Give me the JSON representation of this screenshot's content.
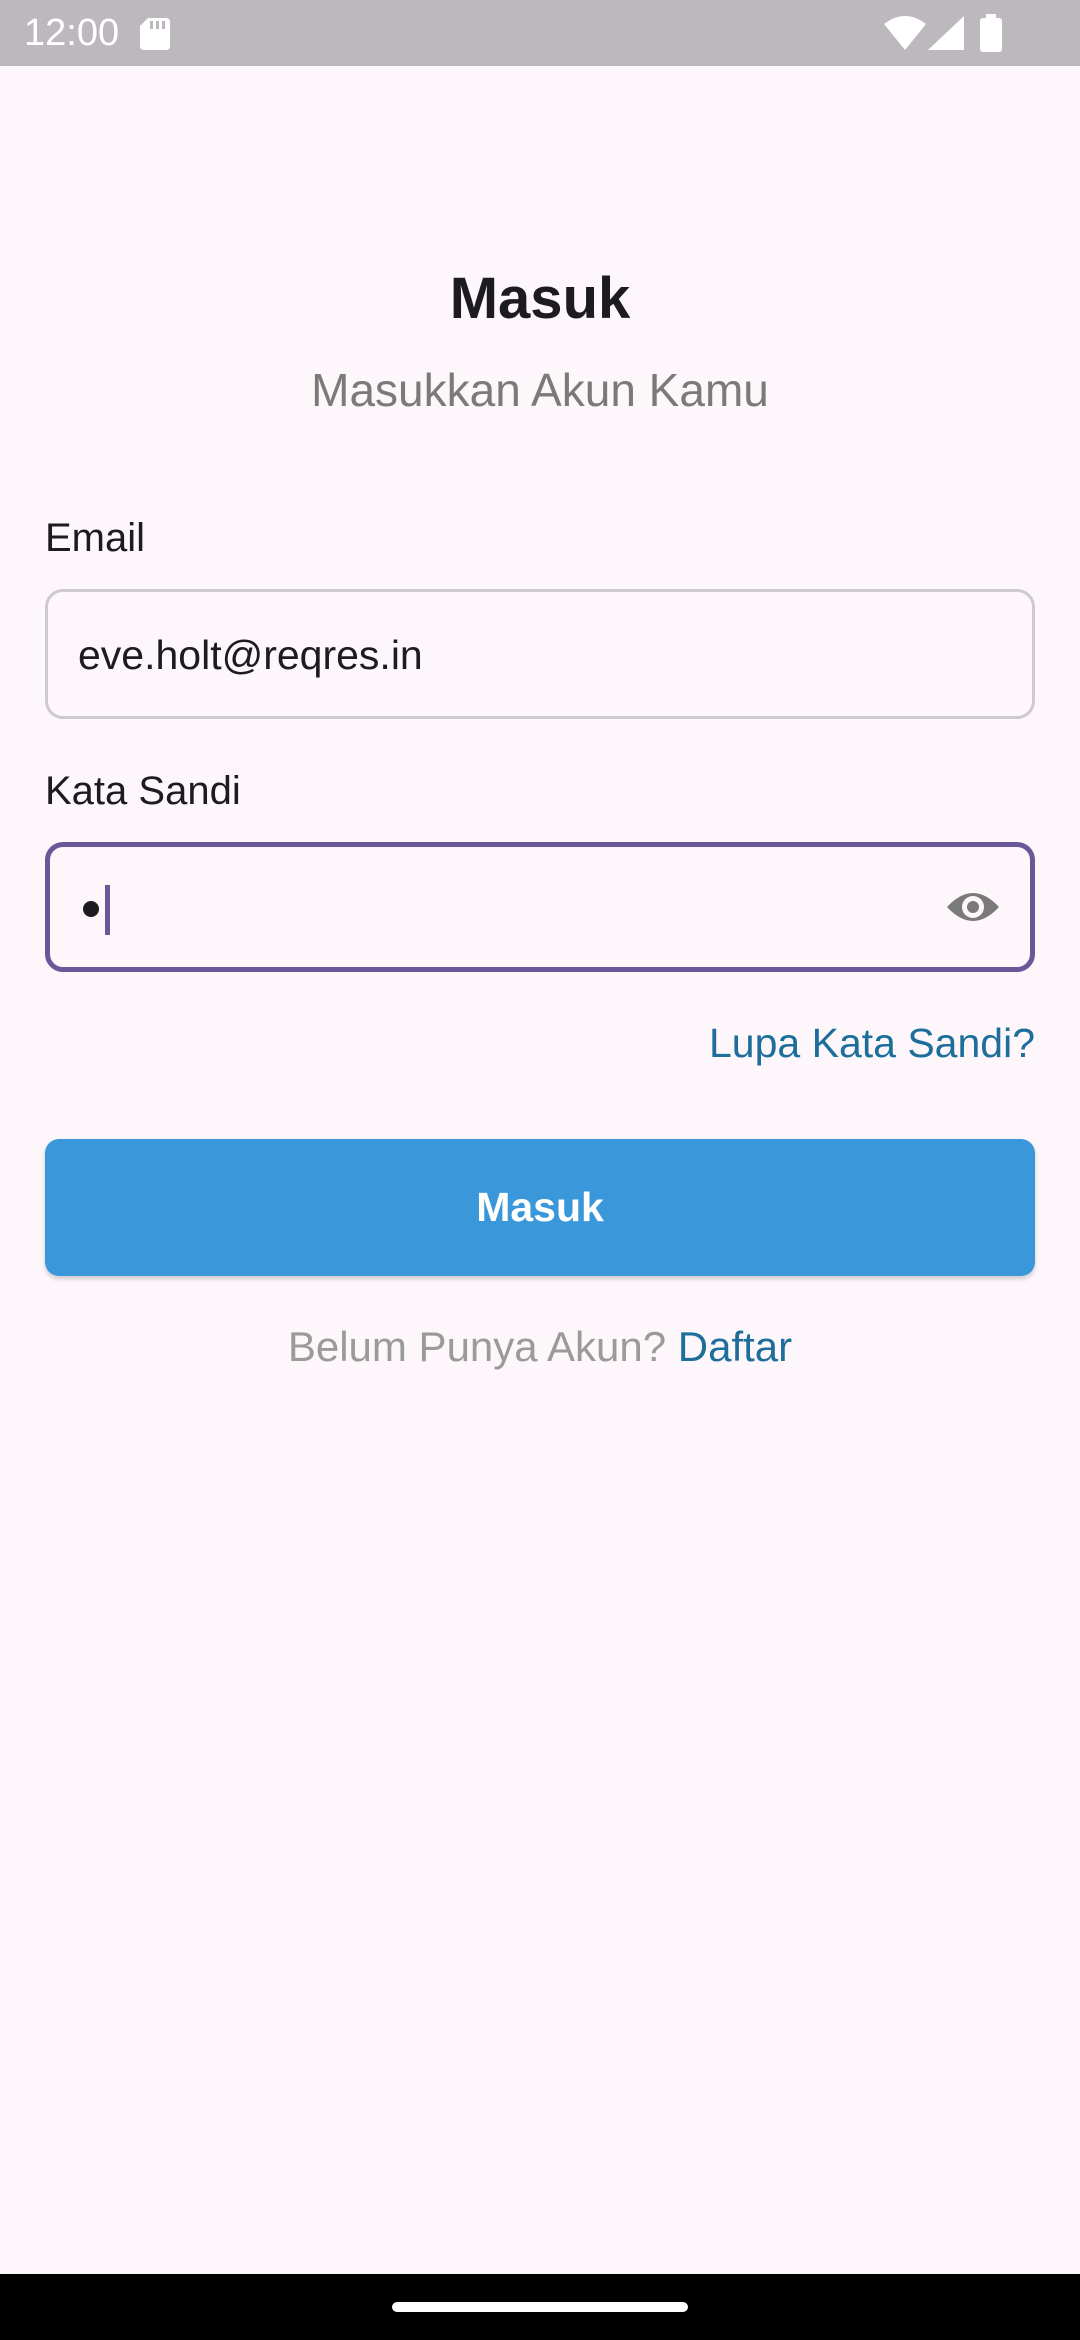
{
  "status_bar": {
    "time": "12:00",
    "icons": [
      "sd-card-icon",
      "wifi-icon",
      "signal-icon",
      "battery-icon"
    ]
  },
  "header": {
    "title": "Masuk",
    "subtitle": "Masukkan Akun Kamu"
  },
  "form": {
    "email": {
      "label": "Email",
      "value": "eve.holt@reqres.in"
    },
    "password": {
      "label": "Kata Sandi",
      "value_masked": "•",
      "toggle_icon": "eye-icon"
    },
    "forgot_password": "Lupa Kata Sandi?",
    "submit_label": "Masuk"
  },
  "footer": {
    "prompt": "Belum Punya Akun?",
    "register_link": "Daftar"
  },
  "colors": {
    "background": "#fdf7fc",
    "accent": "#3a98da",
    "link": "#1d6e9b",
    "focus_border": "#6a5698"
  }
}
